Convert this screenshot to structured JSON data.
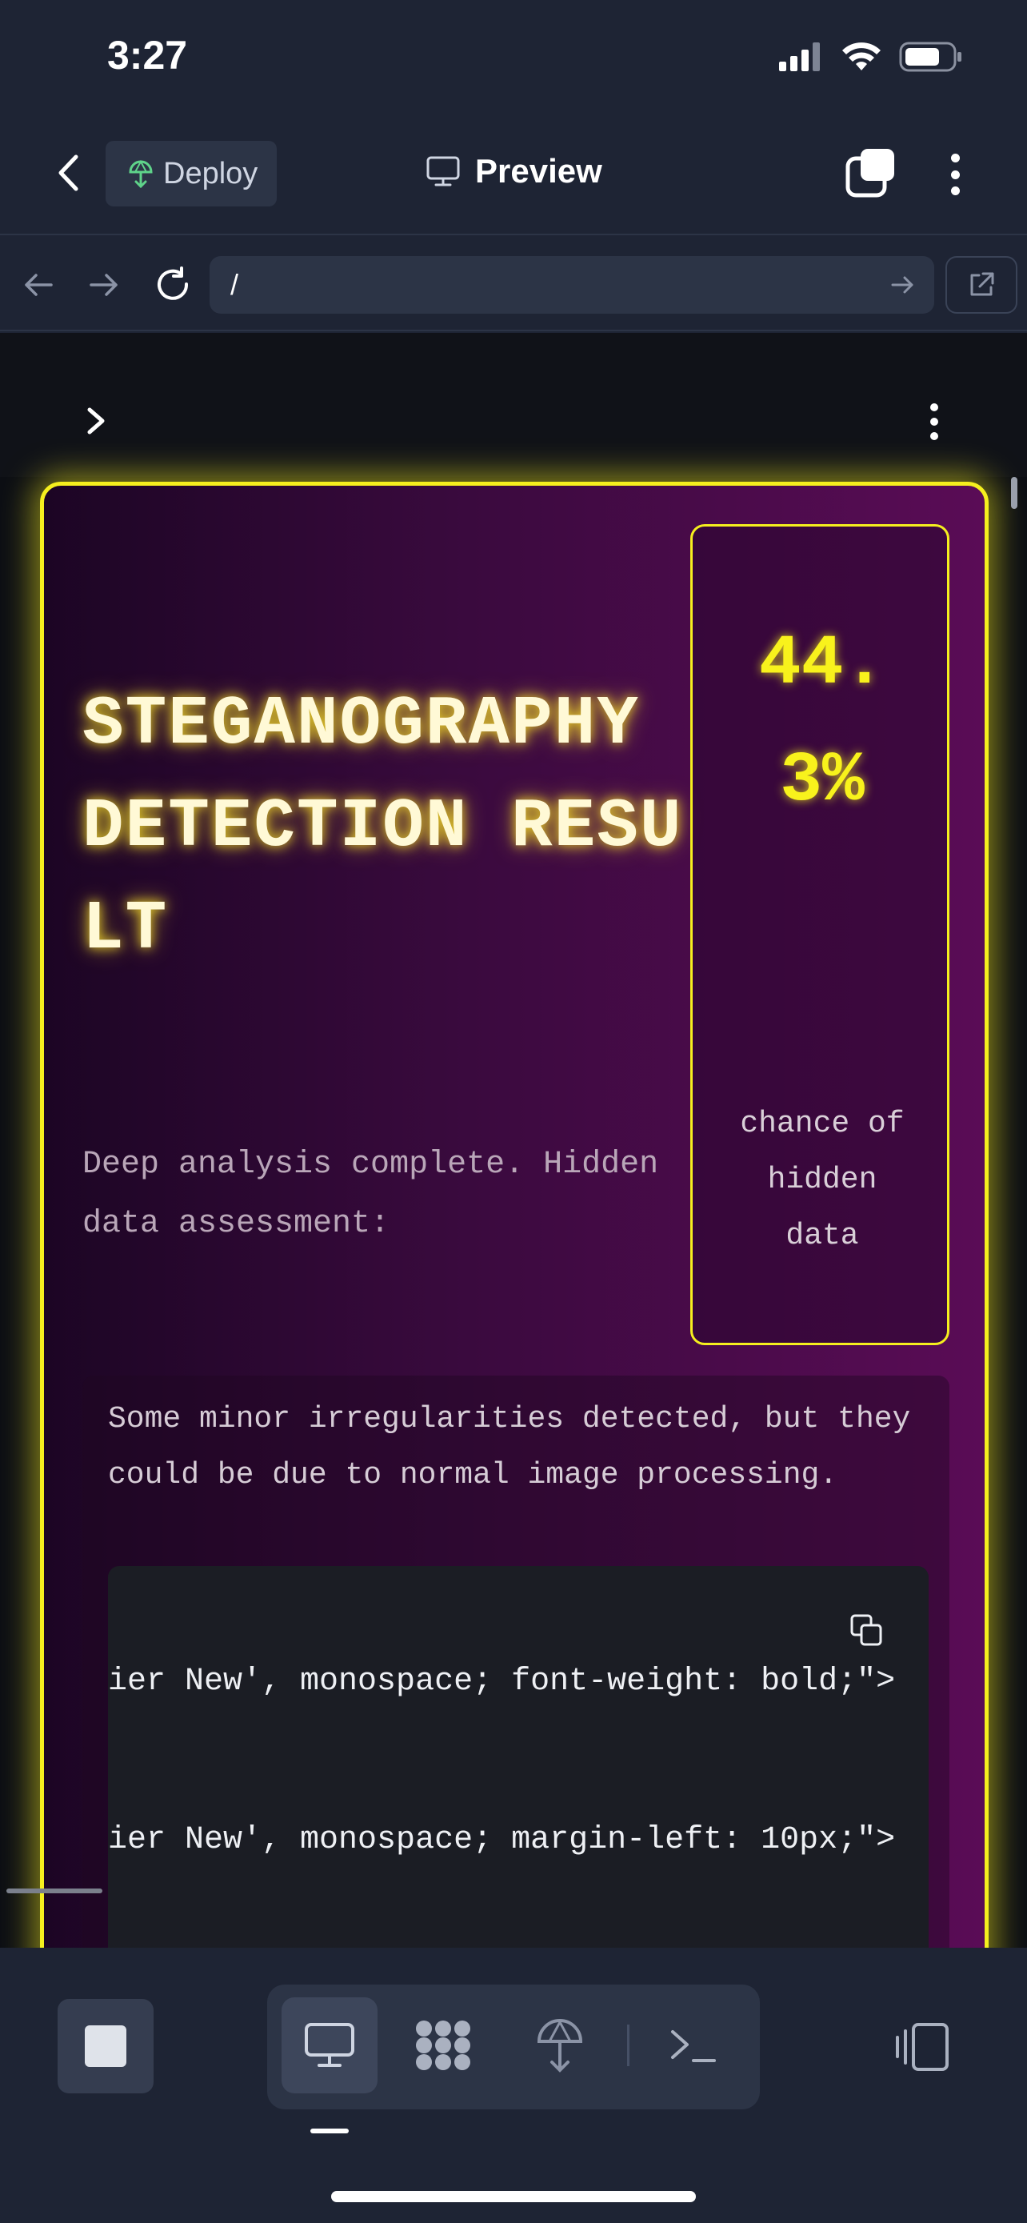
{
  "status_bar": {
    "time": "3:27"
  },
  "header": {
    "deploy_label": "Deploy",
    "title": "Preview"
  },
  "browser": {
    "url": "/"
  },
  "result": {
    "title": "STEGANOGRAPHY DETECTION RESULT",
    "subtitle": "Deep analysis complete. Hidden data assessment:",
    "score": "44.3%",
    "score_caption": "chance of hidden data",
    "message": "Some minor irregularities detected, but they could be due to normal image processing.",
    "code_lines": [
      "ier New', monospace; font-weight: bold;\">",
      "ier New', monospace; margin-left: 10px;\">"
    ]
  },
  "colors": {
    "accent": "#f5ef1e",
    "card_gradient_start": "#1c0524",
    "card_gradient_end": "#5a0c56",
    "background": "#1e2434"
  },
  "icons": [
    "back-icon",
    "deploy-icon",
    "monitor-icon",
    "stack-icon",
    "more-icon",
    "arrow-left-icon",
    "arrow-right-icon",
    "refresh-icon",
    "go-icon",
    "external-link-icon",
    "chevron-right-icon",
    "copy-icon",
    "stop-icon",
    "preview-tab-icon",
    "grid-tab-icon",
    "deploy-tab-icon",
    "terminal-tab-icon",
    "devices-icon"
  ]
}
